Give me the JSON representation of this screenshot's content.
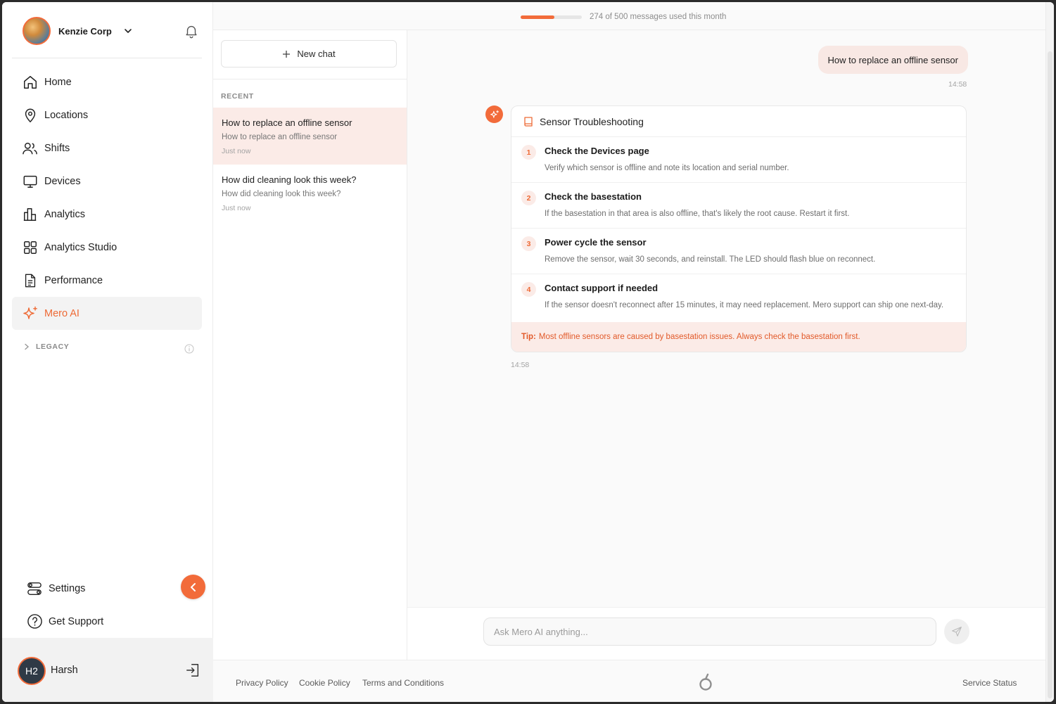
{
  "org": {
    "name": "Kenzie Corp"
  },
  "nav": {
    "items": [
      {
        "label": "Home",
        "icon": "home-icon"
      },
      {
        "label": "Locations",
        "icon": "map-pin-icon"
      },
      {
        "label": "Shifts",
        "icon": "users-icon"
      },
      {
        "label": "Devices",
        "icon": "monitor-icon"
      },
      {
        "label": "Analytics",
        "icon": "bar-chart-icon"
      },
      {
        "label": "Analytics Studio",
        "icon": "grid-icon"
      },
      {
        "label": "Performance",
        "icon": "document-icon"
      },
      {
        "label": "Mero AI",
        "icon": "sparkle-icon",
        "active": true
      }
    ],
    "legacy_label": "LEGACY",
    "settings_label": "Settings",
    "support_label": "Get Support"
  },
  "user": {
    "initials": "H2",
    "name": "Harsh"
  },
  "usage": {
    "used": 274,
    "limit": 500,
    "fraction": 0.548,
    "text": "274 of 500 messages used this month"
  },
  "chatlist": {
    "new_chat_label": "New chat",
    "recent_label": "RECENT",
    "items": [
      {
        "title": "How to replace an offline sensor",
        "preview": "How to replace an offline sensor",
        "date": "Just now",
        "active": true
      },
      {
        "title": "How did cleaning look this week?",
        "preview": "How did cleaning look this week?",
        "date": "Just now"
      }
    ]
  },
  "conversation": {
    "user_message": "How to replace an offline sensor",
    "user_time": "14:58",
    "card_title": "Sensor Troubleshooting",
    "steps": [
      {
        "num": "1",
        "title": "Check the Devices page",
        "desc": "Verify which sensor is offline and note its location and serial number."
      },
      {
        "num": "2",
        "title": "Check the basestation",
        "desc": "If the basestation in that area is also offline, that's likely the root cause. Restart it first."
      },
      {
        "num": "3",
        "title": "Power cycle the sensor",
        "desc": "Remove the sensor, wait 30 seconds, and reinstall. The LED should flash blue on reconnect."
      },
      {
        "num": "4",
        "title": "Contact support if needed",
        "desc": "If the sensor doesn't reconnect after 15 minutes, it may need replacement. Mero support can ship one next-day."
      }
    ],
    "tip_label": "Tip:",
    "tip_text": "Most offline sensors are caused by basestation issues. Always check the basestation first.",
    "ai_time": "14:58"
  },
  "composer": {
    "placeholder": "Ask Mero AI anything..."
  },
  "footer": {
    "privacy": "Privacy Policy",
    "cookie": "Cookie Policy",
    "terms": "Terms and Conditions",
    "status": "Service Status"
  },
  "colors": {
    "accent": "#f26b3a",
    "accent_soft": "#fbebe7"
  }
}
